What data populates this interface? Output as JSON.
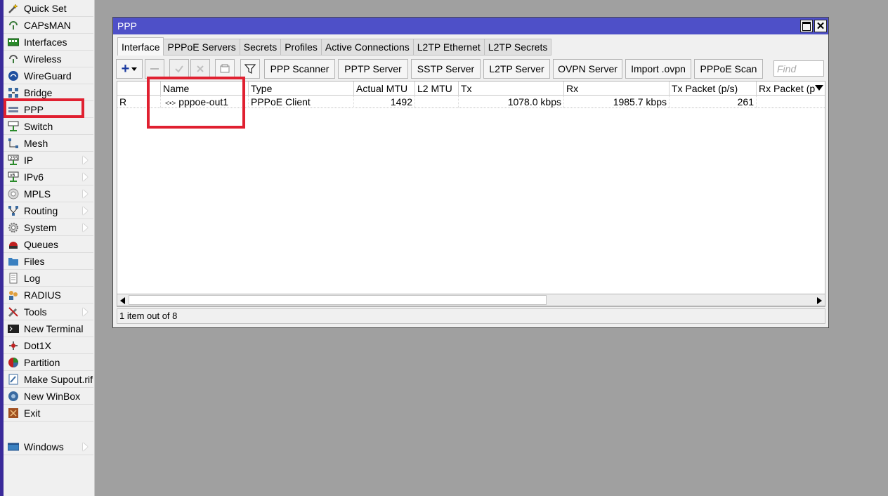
{
  "sidebar": {
    "items": [
      {
        "label": "Quick Set",
        "icon": "quick-set-icon",
        "submenu": false
      },
      {
        "label": "CAPsMAN",
        "icon": "capsman-icon",
        "submenu": false
      },
      {
        "label": "Interfaces",
        "icon": "interfaces-icon",
        "submenu": false
      },
      {
        "label": "Wireless",
        "icon": "wireless-icon",
        "submenu": false
      },
      {
        "label": "WireGuard",
        "icon": "wireguard-icon",
        "submenu": false
      },
      {
        "label": "Bridge",
        "icon": "bridge-icon",
        "submenu": false
      },
      {
        "label": "PPP",
        "icon": "ppp-icon",
        "submenu": false
      },
      {
        "label": "Switch",
        "icon": "switch-icon",
        "submenu": false
      },
      {
        "label": "Mesh",
        "icon": "mesh-icon",
        "submenu": false
      },
      {
        "label": "IP",
        "icon": "ip-icon",
        "submenu": true
      },
      {
        "label": "IPv6",
        "icon": "ipv6-icon",
        "submenu": true
      },
      {
        "label": "MPLS",
        "icon": "mpls-icon",
        "submenu": true
      },
      {
        "label": "Routing",
        "icon": "routing-icon",
        "submenu": true
      },
      {
        "label": "System",
        "icon": "system-icon",
        "submenu": true
      },
      {
        "label": "Queues",
        "icon": "queues-icon",
        "submenu": false
      },
      {
        "label": "Files",
        "icon": "files-icon",
        "submenu": false
      },
      {
        "label": "Log",
        "icon": "log-icon",
        "submenu": false
      },
      {
        "label": "RADIUS",
        "icon": "radius-icon",
        "submenu": false
      },
      {
        "label": "Tools",
        "icon": "tools-icon",
        "submenu": true
      },
      {
        "label": "New Terminal",
        "icon": "terminal-icon",
        "submenu": false
      },
      {
        "label": "Dot1X",
        "icon": "dot1x-icon",
        "submenu": false
      },
      {
        "label": "Partition",
        "icon": "partition-icon",
        "submenu": false
      },
      {
        "label": "Make Supout.rif",
        "icon": "supout-icon",
        "submenu": false
      },
      {
        "label": "New WinBox",
        "icon": "winbox-icon",
        "submenu": false
      },
      {
        "label": "Exit",
        "icon": "exit-icon",
        "submenu": false
      },
      {
        "label": "Windows",
        "icon": "windows-icon",
        "submenu": true
      }
    ]
  },
  "window": {
    "title": "PPP",
    "tabs": [
      "Interface",
      "PPPoE Servers",
      "Secrets",
      "Profiles",
      "Active Connections",
      "L2TP Ethernet",
      "L2TP Secrets"
    ],
    "active_tab": "Interface"
  },
  "toolbar": {
    "add_symbol": "+",
    "buttons": [
      "PPP Scanner",
      "PPTP Server",
      "SSTP Server",
      "L2TP Server",
      "OVPN Server",
      "Import .ovpn",
      "PPPoE Scan"
    ],
    "find_placeholder": "Find"
  },
  "table": {
    "columns": [
      "",
      "Name",
      "Type",
      "Actual MTU",
      "L2 MTU",
      "Tx",
      "Rx",
      "Tx Packet (p/s)",
      "Rx Packet (p"
    ],
    "sort_indicator": "/",
    "rows": [
      {
        "flag": "R",
        "name": "pppoe-out1",
        "name_icon": "<•>",
        "type": "PPPoE Client",
        "actual_mtu": "1492",
        "l2_mtu": "",
        "tx": "1078.0 kbps",
        "rx": "1985.7 kbps",
        "tx_packet": "261",
        "rx_packet": ""
      }
    ]
  },
  "status": {
    "text": "1 item out of 8"
  },
  "colors": {
    "titlebar": "#4e50c8",
    "highlight": "#e02030",
    "desktop": "#a0a0a0",
    "left_strip": "#3a2a9a"
  }
}
